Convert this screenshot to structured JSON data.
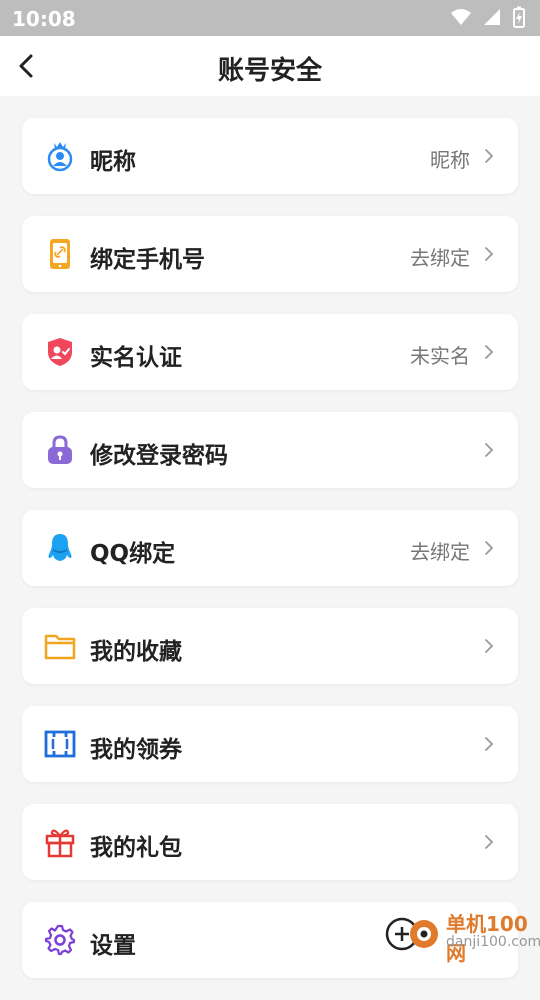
{
  "status_bar": {
    "time": "10:08",
    "icons": [
      "wifi-icon",
      "signal-icon",
      "battery-charging-icon"
    ]
  },
  "header": {
    "title": "账号安全",
    "back_icon": "back-arrow-icon"
  },
  "items": [
    {
      "label": "昵称",
      "value": "昵称",
      "icon": "user-crown-icon",
      "color": "#2a8bf2"
    },
    {
      "label": "绑定手机号",
      "value": "去绑定",
      "icon": "phone-link-icon",
      "color": "#f5a623"
    },
    {
      "label": "实名认证",
      "value": "未实名",
      "icon": "shield-user-icon",
      "color": "#f0475c"
    },
    {
      "label": "修改登录密码",
      "value": "",
      "icon": "lock-icon",
      "color": "#8b6ad8"
    },
    {
      "label": "QQ绑定",
      "value": "去绑定",
      "icon": "qq-penguin-icon",
      "color": "#1da1f2"
    },
    {
      "label": "我的收藏",
      "value": "",
      "icon": "folder-icon",
      "color": "#f2a51e"
    },
    {
      "label": "我的领券",
      "value": "",
      "icon": "coupon-icon",
      "color": "#1e6fd9"
    },
    {
      "label": "我的礼包",
      "value": "",
      "icon": "gift-icon",
      "color": "#e53935"
    },
    {
      "label": "设置",
      "value": "",
      "icon": "gear-icon",
      "color": "#7b3fd6"
    }
  ],
  "watermark": {
    "title": "单机100网",
    "domain": "danji100.com",
    "color": "#e07a2d"
  }
}
